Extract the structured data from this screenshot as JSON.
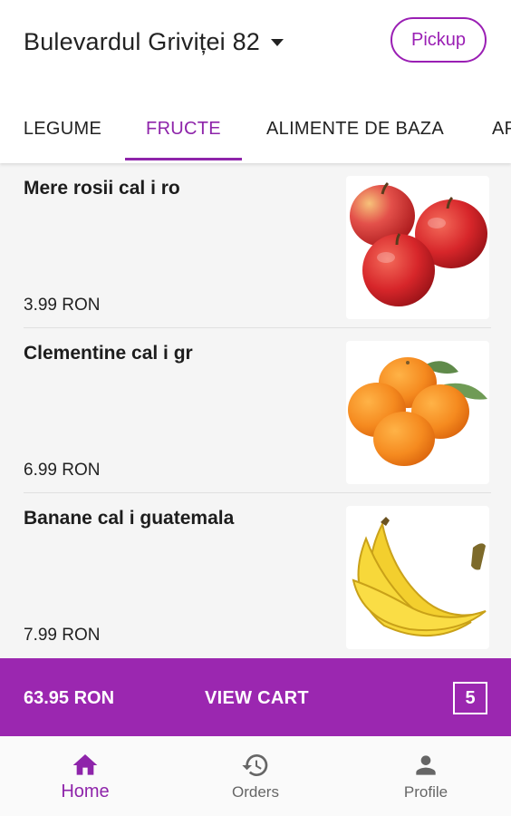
{
  "header": {
    "address": "Bulevardul Griviței 82",
    "pickup_label": "Pickup"
  },
  "tabs": [
    {
      "label": "LEGUME",
      "active": false
    },
    {
      "label": "FRUCTE",
      "active": true
    },
    {
      "label": "ALIMENTE DE BAZA",
      "active": false
    },
    {
      "label": "AP",
      "active": false
    }
  ],
  "products": [
    {
      "name": "Mere rosii cal i ro",
      "price": "3.99 RON",
      "image": "red-apples"
    },
    {
      "name": "Clementine cal i gr",
      "price": "6.99 RON",
      "image": "clementines"
    },
    {
      "name": "Banane cal i guatemala",
      "price": "7.99 RON",
      "image": "bananas"
    }
  ],
  "cart": {
    "total": "63.95 RON",
    "view_label": "VIEW CART",
    "count": "5"
  },
  "bottom_nav": [
    {
      "label": "Home",
      "icon": "home-icon",
      "active": true
    },
    {
      "label": "Orders",
      "icon": "history-icon",
      "active": false
    },
    {
      "label": "Profile",
      "icon": "person-icon",
      "active": false
    }
  ],
  "colors": {
    "accent": "#8e24aa",
    "cart_bar": "#9b27b0",
    "text": "#222222"
  }
}
